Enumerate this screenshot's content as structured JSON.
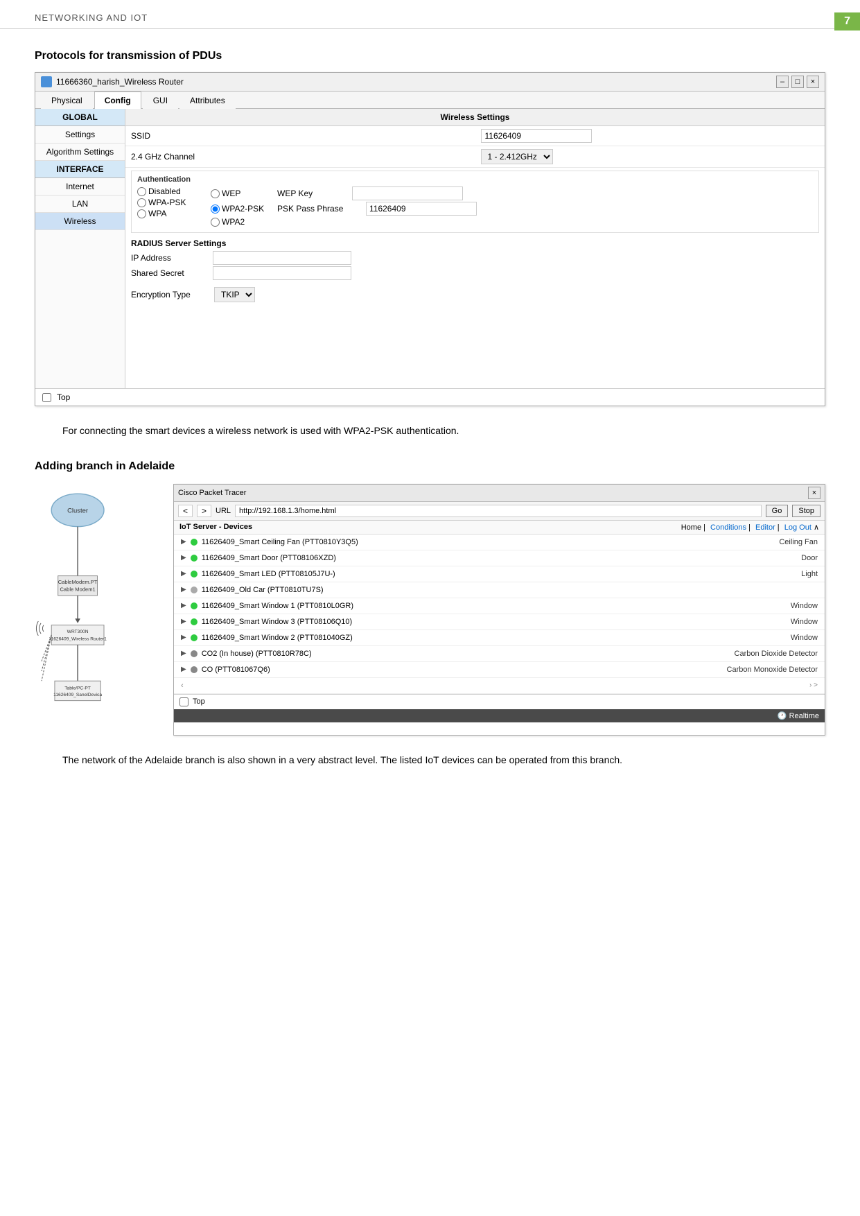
{
  "page": {
    "header_text": "NETWORKING AND IOT",
    "page_number": "7",
    "section1_heading": "Protocols for transmission of PDUs",
    "section2_heading": "Adding branch in Adelaide",
    "para1": "For connecting the smart devices a wireless network is used with WPA2-PSK authentication.",
    "para2": "The network of the Adelaide branch is also shown in a very abstract level. The listed IoT devices can be operated from this branch."
  },
  "router_window": {
    "title": "11666360_harish_Wireless Router",
    "tabs": [
      "Physical",
      "Config",
      "GUI",
      "Attributes"
    ],
    "active_tab": "Config",
    "sidebar": {
      "global_label": "GLOBAL",
      "global_items": [
        "Settings",
        "Algorithm Settings"
      ],
      "interface_label": "INTERFACE",
      "interface_items": [
        "Internet",
        "LAN",
        "Wireless"
      ]
    },
    "wireless_settings": {
      "section_title": "Wireless Settings",
      "ssid_label": "SSID",
      "ssid_value": "11626409",
      "channel_label": "2.4 GHz Channel",
      "channel_value": "1 - 2.412GHz",
      "auth_label": "Authentication",
      "auth_options": [
        "Disabled",
        "WPA-PSK",
        "WPA",
        "WEP",
        "WPA2-PSK",
        "WPA2"
      ],
      "selected_auth": "WPA2-PSK",
      "wep_key_label": "WEP Key",
      "psk_label": "PSK Pass Phrase",
      "psk_value": "11626409",
      "radius_label": "RADIUS Server Settings",
      "ip_label": "IP Address",
      "shared_label": "Shared Secret",
      "encryption_label": "Encryption Type",
      "encryption_value": "TKIP"
    },
    "footer_checkbox": "Top",
    "controls": {
      "minimize": "–",
      "maximize": "□",
      "close": "×"
    }
  },
  "iot_window": {
    "titlebar": "Cisco Packet Tracer",
    "close_btn": "×",
    "url": "http://192.168.1.3/home.html",
    "go_btn": "Go",
    "stop_btn": "Stop",
    "nav_left": "IoT Server - Devices",
    "nav_right": [
      "Home",
      "Conditions",
      "Editor",
      "Log Out"
    ],
    "devices": [
      {
        "name": "11626409_Smart Ceiling Fan (PTT0810Y3Q5)",
        "type": "Ceiling Fan",
        "dot_class": "dot-green"
      },
      {
        "name": "11626409_Smart Door (PTT08106XZD)",
        "type": "Door",
        "dot_class": "dot-green"
      },
      {
        "name": "11626409_Smart LED (PTT08105J7U-)",
        "type": "Light",
        "dot_class": "dot-green"
      },
      {
        "name": "11626409_Old Car (PTT0810TU7S)",
        "type": "",
        "dot_class": "dot-gray"
      },
      {
        "name": "11626409_Smart Window 1 (PTT0810L0GR)",
        "type": "Window",
        "dot_class": "dot-green"
      },
      {
        "name": "11626409_Smart Window 3 (PTT08106Q10)",
        "type": "Window",
        "dot_class": "dot-green"
      },
      {
        "name": "11626409_Smart Window 2 (PTT081040GZ)",
        "type": "Window",
        "dot_class": "dot-green"
      },
      {
        "name": "CO2 (In house) (PTT0810R78C)",
        "type": "Carbon Dioxide Detector",
        "dot_class": "dot-gray-co"
      },
      {
        "name": "CO (PTT081067Q6)",
        "type": "Carbon Monoxide Detector",
        "dot_class": "dot-gray-co"
      }
    ],
    "footer_checkbox": "Top",
    "bottom_bar": "Realtime"
  },
  "algorithm_settings_label": "Algorithm Settings"
}
